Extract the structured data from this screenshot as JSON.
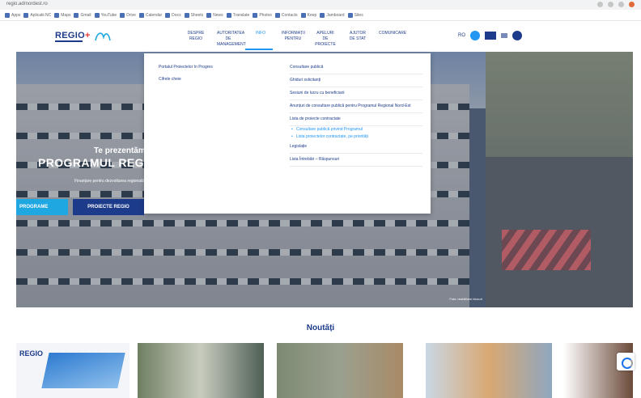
{
  "browser": {
    "url": "regio.adrnordest.ro",
    "bookmarks": [
      "Apps",
      "Aplicatii NC",
      "Maps",
      "Gmail",
      "YouTube",
      "Drive",
      "Calendar",
      "Docs",
      "Sheets",
      "News",
      "Translate",
      "Photos",
      "Contacts",
      "Keep",
      "Jamboard",
      "Sites"
    ]
  },
  "header": {
    "logo_text": "REGIO",
    "logo_plus": "+",
    "nav": [
      {
        "label": "DESPRE REGIO"
      },
      {
        "label": "AUTORITATEA DE MANAGEMENT"
      },
      {
        "label": "INFO"
      },
      {
        "label": "INFORMAȚII PENTRU"
      },
      {
        "label": "APELURI DE PROIECTE"
      },
      {
        "label": "AJUTOR DE STAT"
      },
      {
        "label": "COMUNICARE"
      }
    ],
    "lang": "RO",
    "colors": {
      "primary": "#1d3b8b",
      "accent": "#2196f3"
    }
  },
  "dropdown": {
    "left": [
      {
        "label": "Portalul Proiectelor în Progres"
      },
      {
        "label": "Cifrele cheie"
      }
    ],
    "right": [
      {
        "label": "Consultare publică"
      },
      {
        "label": "Ghiduri solicitanți"
      },
      {
        "label": "Sesiuni de lucru cu beneficiarii"
      },
      {
        "label": "Anunțuri de consultare publică pentru Programul Regional Nord-Est"
      },
      {
        "label": "Lista de proiecte contractate"
      },
      {
        "label": "Legislație"
      },
      {
        "label": "Lista Întrebări – Răspunsuri"
      }
    ],
    "right_sub": [
      {
        "label": "Consultare publică privind Programul"
      },
      {
        "label": "Lista proiectelor contractate, pe priorități"
      }
    ]
  },
  "hero": {
    "small_title": "Te prezentăm",
    "big_title": "PROGRAMUL REGIO",
    "subtitle": "Finanțare pentru dezvoltarea regională",
    "btn1": "PROGRAME",
    "btn2": "PROIECTE REGIO",
    "caption": "Foto: reabilitare blocuri"
  },
  "news": {
    "title": "Noutăți",
    "thumb1_logo": "REGIO"
  }
}
